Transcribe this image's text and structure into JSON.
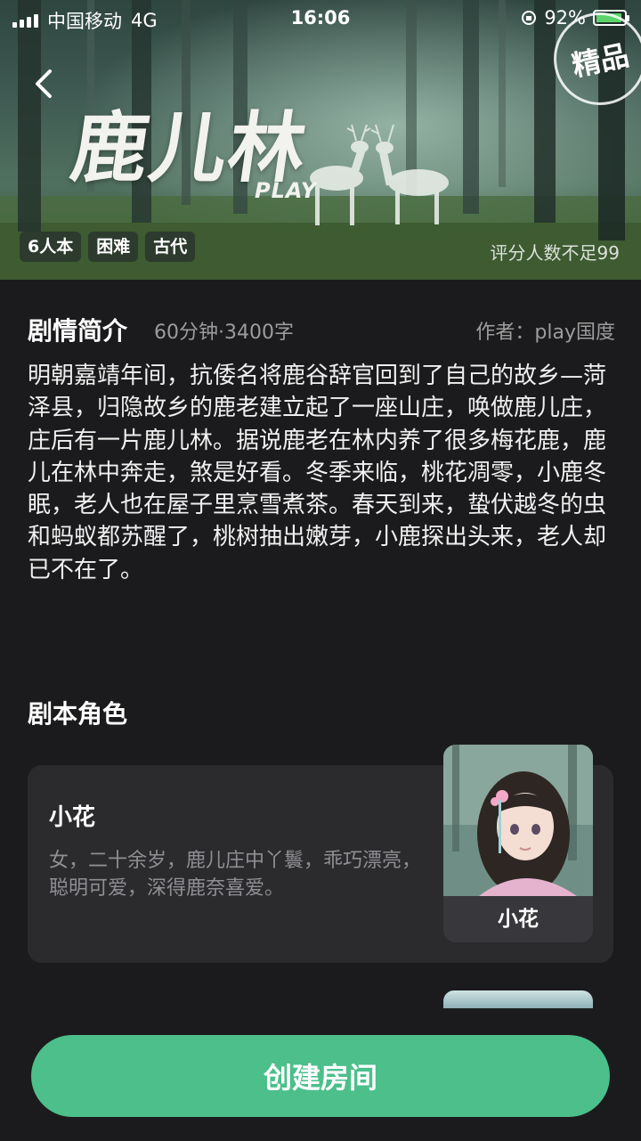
{
  "status_bar": {
    "carrier": "中国移动",
    "network": "4G",
    "time": "16:06",
    "battery": "92%",
    "battery_level": 0.92
  },
  "hero": {
    "title_art": "鹿儿林",
    "title_sub": "PLAY",
    "stamp": "精品",
    "tags": [
      "6人本",
      "困难",
      "古代"
    ],
    "rating_note": "评分人数不足99"
  },
  "intro": {
    "title": "剧情简介",
    "meta": "60分钟·3400字",
    "author": "作者：play国度",
    "text": "明朝嘉靖年间，抗倭名将鹿谷辞官回到了自己的故乡—菏泽县，归隐故乡的鹿老建立起了一座山庄，唤做鹿儿庄，庄后有一片鹿儿林。据说鹿老在林内养了很多梅花鹿，鹿儿在林中奔走，煞是好看。冬季来临，桃花凋零，小鹿冬眠，老人也在屋子里烹雪煮茶。春天到来，蛰伏越冬的虫和蚂蚁都苏醒了，桃树抽出嫩芽，小鹿探出头来，老人却已不在了。"
  },
  "roles": {
    "title": "剧本角色",
    "items": [
      {
        "name": "小花",
        "description": "女，二十余岁，鹿儿庄中丫鬟，乖巧漂亮，聪明可爱，深得鹿奈喜爱。",
        "portrait_label": "小花"
      }
    ]
  },
  "cta": {
    "label": "创建房间"
  },
  "colors": {
    "accent": "#4cbf8b",
    "background": "#1b1b1d",
    "card": "#2b2b2e"
  }
}
